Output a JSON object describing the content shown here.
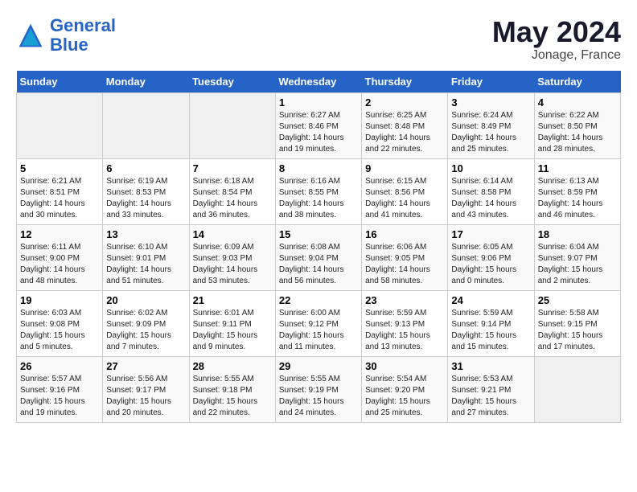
{
  "header": {
    "logo_general": "General",
    "logo_blue": "Blue",
    "month": "May 2024",
    "location": "Jonage, France"
  },
  "weekdays": [
    "Sunday",
    "Monday",
    "Tuesday",
    "Wednesday",
    "Thursday",
    "Friday",
    "Saturday"
  ],
  "weeks": [
    [
      {
        "day": "",
        "info": ""
      },
      {
        "day": "",
        "info": ""
      },
      {
        "day": "",
        "info": ""
      },
      {
        "day": "1",
        "info": "Sunrise: 6:27 AM\nSunset: 8:46 PM\nDaylight: 14 hours\nand 19 minutes."
      },
      {
        "day": "2",
        "info": "Sunrise: 6:25 AM\nSunset: 8:48 PM\nDaylight: 14 hours\nand 22 minutes."
      },
      {
        "day": "3",
        "info": "Sunrise: 6:24 AM\nSunset: 8:49 PM\nDaylight: 14 hours\nand 25 minutes."
      },
      {
        "day": "4",
        "info": "Sunrise: 6:22 AM\nSunset: 8:50 PM\nDaylight: 14 hours\nand 28 minutes."
      }
    ],
    [
      {
        "day": "5",
        "info": "Sunrise: 6:21 AM\nSunset: 8:51 PM\nDaylight: 14 hours\nand 30 minutes."
      },
      {
        "day": "6",
        "info": "Sunrise: 6:19 AM\nSunset: 8:53 PM\nDaylight: 14 hours\nand 33 minutes."
      },
      {
        "day": "7",
        "info": "Sunrise: 6:18 AM\nSunset: 8:54 PM\nDaylight: 14 hours\nand 36 minutes."
      },
      {
        "day": "8",
        "info": "Sunrise: 6:16 AM\nSunset: 8:55 PM\nDaylight: 14 hours\nand 38 minutes."
      },
      {
        "day": "9",
        "info": "Sunrise: 6:15 AM\nSunset: 8:56 PM\nDaylight: 14 hours\nand 41 minutes."
      },
      {
        "day": "10",
        "info": "Sunrise: 6:14 AM\nSunset: 8:58 PM\nDaylight: 14 hours\nand 43 minutes."
      },
      {
        "day": "11",
        "info": "Sunrise: 6:13 AM\nSunset: 8:59 PM\nDaylight: 14 hours\nand 46 minutes."
      }
    ],
    [
      {
        "day": "12",
        "info": "Sunrise: 6:11 AM\nSunset: 9:00 PM\nDaylight: 14 hours\nand 48 minutes."
      },
      {
        "day": "13",
        "info": "Sunrise: 6:10 AM\nSunset: 9:01 PM\nDaylight: 14 hours\nand 51 minutes."
      },
      {
        "day": "14",
        "info": "Sunrise: 6:09 AM\nSunset: 9:03 PM\nDaylight: 14 hours\nand 53 minutes."
      },
      {
        "day": "15",
        "info": "Sunrise: 6:08 AM\nSunset: 9:04 PM\nDaylight: 14 hours\nand 56 minutes."
      },
      {
        "day": "16",
        "info": "Sunrise: 6:06 AM\nSunset: 9:05 PM\nDaylight: 14 hours\nand 58 minutes."
      },
      {
        "day": "17",
        "info": "Sunrise: 6:05 AM\nSunset: 9:06 PM\nDaylight: 15 hours\nand 0 minutes."
      },
      {
        "day": "18",
        "info": "Sunrise: 6:04 AM\nSunset: 9:07 PM\nDaylight: 15 hours\nand 2 minutes."
      }
    ],
    [
      {
        "day": "19",
        "info": "Sunrise: 6:03 AM\nSunset: 9:08 PM\nDaylight: 15 hours\nand 5 minutes."
      },
      {
        "day": "20",
        "info": "Sunrise: 6:02 AM\nSunset: 9:09 PM\nDaylight: 15 hours\nand 7 minutes."
      },
      {
        "day": "21",
        "info": "Sunrise: 6:01 AM\nSunset: 9:11 PM\nDaylight: 15 hours\nand 9 minutes."
      },
      {
        "day": "22",
        "info": "Sunrise: 6:00 AM\nSunset: 9:12 PM\nDaylight: 15 hours\nand 11 minutes."
      },
      {
        "day": "23",
        "info": "Sunrise: 5:59 AM\nSunset: 9:13 PM\nDaylight: 15 hours\nand 13 minutes."
      },
      {
        "day": "24",
        "info": "Sunrise: 5:59 AM\nSunset: 9:14 PM\nDaylight: 15 hours\nand 15 minutes."
      },
      {
        "day": "25",
        "info": "Sunrise: 5:58 AM\nSunset: 9:15 PM\nDaylight: 15 hours\nand 17 minutes."
      }
    ],
    [
      {
        "day": "26",
        "info": "Sunrise: 5:57 AM\nSunset: 9:16 PM\nDaylight: 15 hours\nand 19 minutes."
      },
      {
        "day": "27",
        "info": "Sunrise: 5:56 AM\nSunset: 9:17 PM\nDaylight: 15 hours\nand 20 minutes."
      },
      {
        "day": "28",
        "info": "Sunrise: 5:55 AM\nSunset: 9:18 PM\nDaylight: 15 hours\nand 22 minutes."
      },
      {
        "day": "29",
        "info": "Sunrise: 5:55 AM\nSunset: 9:19 PM\nDaylight: 15 hours\nand 24 minutes."
      },
      {
        "day": "30",
        "info": "Sunrise: 5:54 AM\nSunset: 9:20 PM\nDaylight: 15 hours\nand 25 minutes."
      },
      {
        "day": "31",
        "info": "Sunrise: 5:53 AM\nSunset: 9:21 PM\nDaylight: 15 hours\nand 27 minutes."
      },
      {
        "day": "",
        "info": ""
      }
    ]
  ]
}
